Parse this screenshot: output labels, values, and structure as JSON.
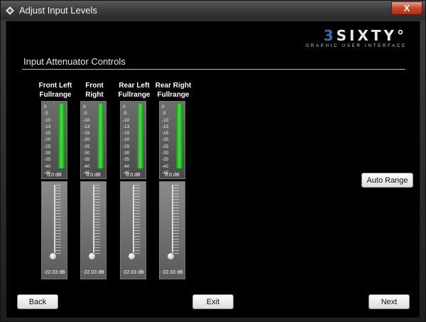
{
  "window": {
    "title": "Adjust Input Levels",
    "close_label": "X"
  },
  "logo": {
    "prefix": "3",
    "name": "SIXTY°",
    "subtitle": "GRAPHIC USER INTERFACE"
  },
  "section_title": "Input Attenuator Controls",
  "meter_ticks": [
    "0",
    "-5",
    "-10",
    "-13",
    "-15",
    "-20",
    "-25",
    "-30",
    "-35",
    "-40",
    "-45"
  ],
  "channels": [
    {
      "line1": "Front Left",
      "line2": "Fullrange",
      "meter_value": "0.0 dB",
      "meter_level": 1.0,
      "fader_value": "-22.03 dB",
      "fader_level": 0.0
    },
    {
      "line1": "Front",
      "line2": "Right",
      "meter_value": "0.0 dB",
      "meter_level": 1.0,
      "fader_value": "-22.03 dB",
      "fader_level": 0.0
    },
    {
      "line1": "Rear Left",
      "line2": "Fullrange",
      "meter_value": "0.0 dB",
      "meter_level": 1.0,
      "fader_value": "-22.03 dB",
      "fader_level": 0.0
    },
    {
      "line1": "Rear Right",
      "line2": "Fullrange",
      "meter_value": "0.0 dB",
      "meter_level": 1.0,
      "fader_value": "-22.03 dB",
      "fader_level": 0.0
    }
  ],
  "buttons": {
    "auto_range": "Auto Range",
    "back": "Back",
    "exit": "Exit",
    "next": "Next"
  },
  "colors": {
    "meter_green": "#46e046",
    "background": "#000000",
    "logo_accent": "#3a6ea8"
  }
}
